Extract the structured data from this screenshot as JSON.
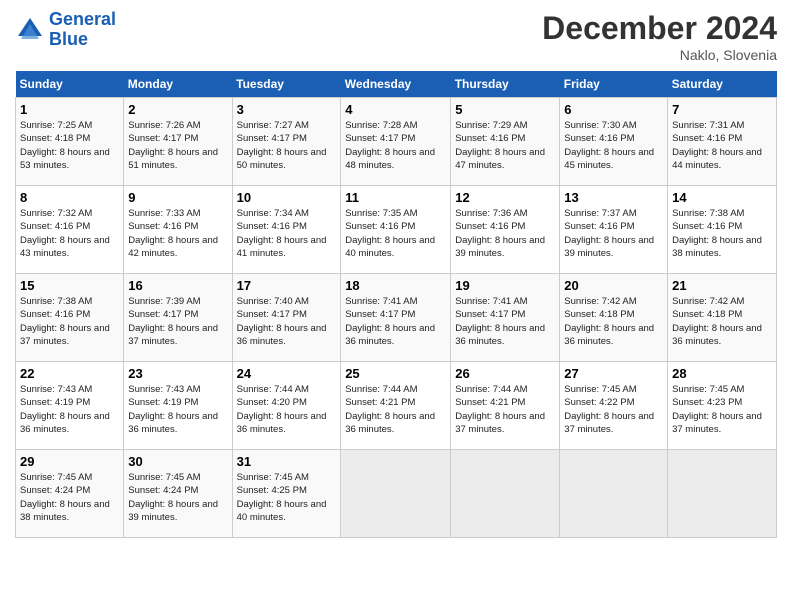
{
  "header": {
    "logo_line1": "General",
    "logo_line2": "Blue",
    "month": "December 2024",
    "location": "Naklo, Slovenia"
  },
  "weekdays": [
    "Sunday",
    "Monday",
    "Tuesday",
    "Wednesday",
    "Thursday",
    "Friday",
    "Saturday"
  ],
  "weeks": [
    [
      {
        "day": "1",
        "sunrise": "Sunrise: 7:25 AM",
        "sunset": "Sunset: 4:18 PM",
        "daylight": "Daylight: 8 hours and 53 minutes."
      },
      {
        "day": "2",
        "sunrise": "Sunrise: 7:26 AM",
        "sunset": "Sunset: 4:17 PM",
        "daylight": "Daylight: 8 hours and 51 minutes."
      },
      {
        "day": "3",
        "sunrise": "Sunrise: 7:27 AM",
        "sunset": "Sunset: 4:17 PM",
        "daylight": "Daylight: 8 hours and 50 minutes."
      },
      {
        "day": "4",
        "sunrise": "Sunrise: 7:28 AM",
        "sunset": "Sunset: 4:17 PM",
        "daylight": "Daylight: 8 hours and 48 minutes."
      },
      {
        "day": "5",
        "sunrise": "Sunrise: 7:29 AM",
        "sunset": "Sunset: 4:16 PM",
        "daylight": "Daylight: 8 hours and 47 minutes."
      },
      {
        "day": "6",
        "sunrise": "Sunrise: 7:30 AM",
        "sunset": "Sunset: 4:16 PM",
        "daylight": "Daylight: 8 hours and 45 minutes."
      },
      {
        "day": "7",
        "sunrise": "Sunrise: 7:31 AM",
        "sunset": "Sunset: 4:16 PM",
        "daylight": "Daylight: 8 hours and 44 minutes."
      }
    ],
    [
      {
        "day": "8",
        "sunrise": "Sunrise: 7:32 AM",
        "sunset": "Sunset: 4:16 PM",
        "daylight": "Daylight: 8 hours and 43 minutes."
      },
      {
        "day": "9",
        "sunrise": "Sunrise: 7:33 AM",
        "sunset": "Sunset: 4:16 PM",
        "daylight": "Daylight: 8 hours and 42 minutes."
      },
      {
        "day": "10",
        "sunrise": "Sunrise: 7:34 AM",
        "sunset": "Sunset: 4:16 PM",
        "daylight": "Daylight: 8 hours and 41 minutes."
      },
      {
        "day": "11",
        "sunrise": "Sunrise: 7:35 AM",
        "sunset": "Sunset: 4:16 PM",
        "daylight": "Daylight: 8 hours and 40 minutes."
      },
      {
        "day": "12",
        "sunrise": "Sunrise: 7:36 AM",
        "sunset": "Sunset: 4:16 PM",
        "daylight": "Daylight: 8 hours and 39 minutes."
      },
      {
        "day": "13",
        "sunrise": "Sunrise: 7:37 AM",
        "sunset": "Sunset: 4:16 PM",
        "daylight": "Daylight: 8 hours and 39 minutes."
      },
      {
        "day": "14",
        "sunrise": "Sunrise: 7:38 AM",
        "sunset": "Sunset: 4:16 PM",
        "daylight": "Daylight: 8 hours and 38 minutes."
      }
    ],
    [
      {
        "day": "15",
        "sunrise": "Sunrise: 7:38 AM",
        "sunset": "Sunset: 4:16 PM",
        "daylight": "Daylight: 8 hours and 37 minutes."
      },
      {
        "day": "16",
        "sunrise": "Sunrise: 7:39 AM",
        "sunset": "Sunset: 4:17 PM",
        "daylight": "Daylight: 8 hours and 37 minutes."
      },
      {
        "day": "17",
        "sunrise": "Sunrise: 7:40 AM",
        "sunset": "Sunset: 4:17 PM",
        "daylight": "Daylight: 8 hours and 36 minutes."
      },
      {
        "day": "18",
        "sunrise": "Sunrise: 7:41 AM",
        "sunset": "Sunset: 4:17 PM",
        "daylight": "Daylight: 8 hours and 36 minutes."
      },
      {
        "day": "19",
        "sunrise": "Sunrise: 7:41 AM",
        "sunset": "Sunset: 4:17 PM",
        "daylight": "Daylight: 8 hours and 36 minutes."
      },
      {
        "day": "20",
        "sunrise": "Sunrise: 7:42 AM",
        "sunset": "Sunset: 4:18 PM",
        "daylight": "Daylight: 8 hours and 36 minutes."
      },
      {
        "day": "21",
        "sunrise": "Sunrise: 7:42 AM",
        "sunset": "Sunset: 4:18 PM",
        "daylight": "Daylight: 8 hours and 36 minutes."
      }
    ],
    [
      {
        "day": "22",
        "sunrise": "Sunrise: 7:43 AM",
        "sunset": "Sunset: 4:19 PM",
        "daylight": "Daylight: 8 hours and 36 minutes."
      },
      {
        "day": "23",
        "sunrise": "Sunrise: 7:43 AM",
        "sunset": "Sunset: 4:19 PM",
        "daylight": "Daylight: 8 hours and 36 minutes."
      },
      {
        "day": "24",
        "sunrise": "Sunrise: 7:44 AM",
        "sunset": "Sunset: 4:20 PM",
        "daylight": "Daylight: 8 hours and 36 minutes."
      },
      {
        "day": "25",
        "sunrise": "Sunrise: 7:44 AM",
        "sunset": "Sunset: 4:21 PM",
        "daylight": "Daylight: 8 hours and 36 minutes."
      },
      {
        "day": "26",
        "sunrise": "Sunrise: 7:44 AM",
        "sunset": "Sunset: 4:21 PM",
        "daylight": "Daylight: 8 hours and 37 minutes."
      },
      {
        "day": "27",
        "sunrise": "Sunrise: 7:45 AM",
        "sunset": "Sunset: 4:22 PM",
        "daylight": "Daylight: 8 hours and 37 minutes."
      },
      {
        "day": "28",
        "sunrise": "Sunrise: 7:45 AM",
        "sunset": "Sunset: 4:23 PM",
        "daylight": "Daylight: 8 hours and 37 minutes."
      }
    ],
    [
      {
        "day": "29",
        "sunrise": "Sunrise: 7:45 AM",
        "sunset": "Sunset: 4:24 PM",
        "daylight": "Daylight: 8 hours and 38 minutes."
      },
      {
        "day": "30",
        "sunrise": "Sunrise: 7:45 AM",
        "sunset": "Sunset: 4:24 PM",
        "daylight": "Daylight: 8 hours and 39 minutes."
      },
      {
        "day": "31",
        "sunrise": "Sunrise: 7:45 AM",
        "sunset": "Sunset: 4:25 PM",
        "daylight": "Daylight: 8 hours and 40 minutes."
      },
      null,
      null,
      null,
      null
    ]
  ]
}
